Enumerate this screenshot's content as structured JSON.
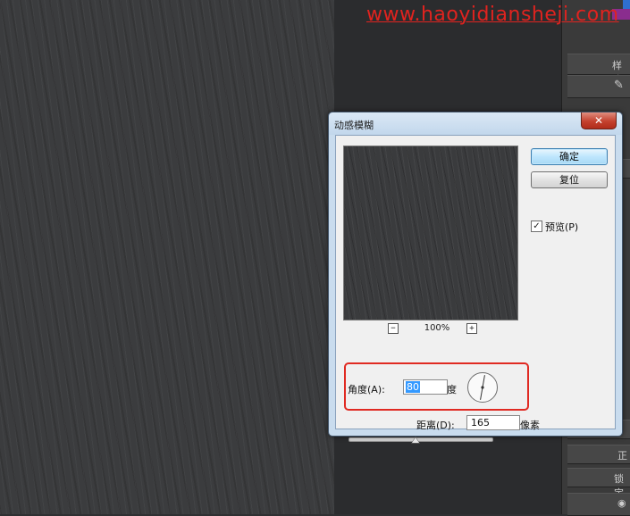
{
  "watermark": "www.haoyidiansheji.com",
  "dialog": {
    "title": "动感模糊",
    "close_label": "✕",
    "buttons": {
      "ok": "确定",
      "reset": "复位"
    },
    "preview_checkbox": {
      "label": "预览(P)",
      "checked": true,
      "mark": "✓"
    },
    "zoom": {
      "minus": "−",
      "plus": "+",
      "level": "100%"
    },
    "angle": {
      "label": "角度(A):",
      "value": "80",
      "unit": "度",
      "degrees": 80
    },
    "distance": {
      "label": "距离(D):",
      "value": "165",
      "unit": "像素",
      "slider_fraction": 0.46
    }
  },
  "right_panel": {
    "labels": [
      "样式",
      "正",
      "锁定"
    ]
  }
}
